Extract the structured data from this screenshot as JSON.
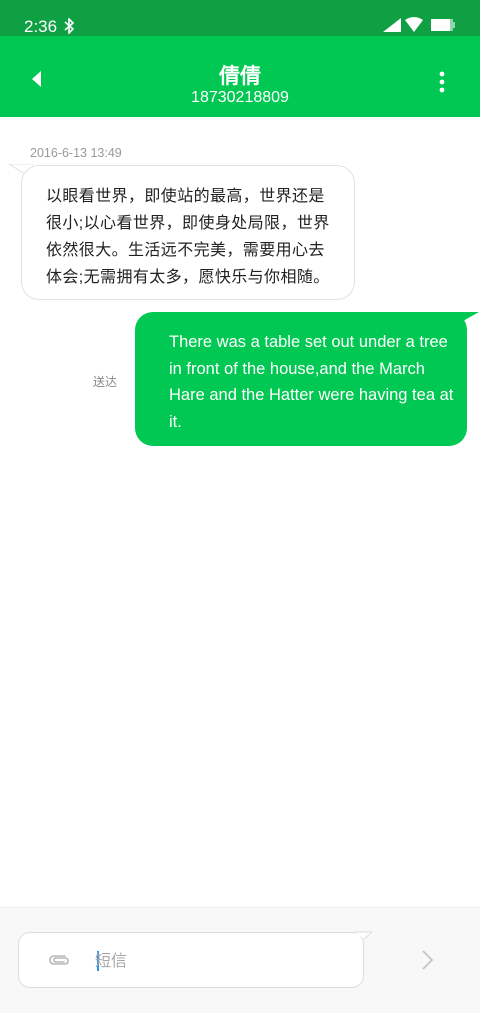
{
  "status_bar": {
    "time": "2:36",
    "icons": [
      "bluetooth-icon",
      "signal-icon",
      "wifi-icon",
      "battery-icon"
    ]
  },
  "header": {
    "contact_name": "倩倩",
    "contact_number": "18730218809",
    "icons": [
      "back-icon",
      "more-icon"
    ]
  },
  "conversation": {
    "timestamp": "2016-6-13 13:49",
    "received_message": "以眼看世界，即使站的最高，世界还是很小;以心看世界，即使身处局限，世界依然很大。生活远不完美，需要用心去体会;无需拥有太多，愿快乐与你相随。",
    "sent_message": "There was a table set out under a tree in front of the house,and the March Hare and the Hatter were having tea at it.",
    "sent_status": "送达"
  },
  "composer": {
    "placeholder": "短信",
    "value": "",
    "icons": [
      "attach-icon",
      "send-icon"
    ]
  },
  "colors": {
    "status_bar": "#0fa043",
    "app_bar": "#00c853",
    "sent_bubble": "#00c853",
    "received_bubble": "#ffffff",
    "caret": "#2196f3"
  }
}
